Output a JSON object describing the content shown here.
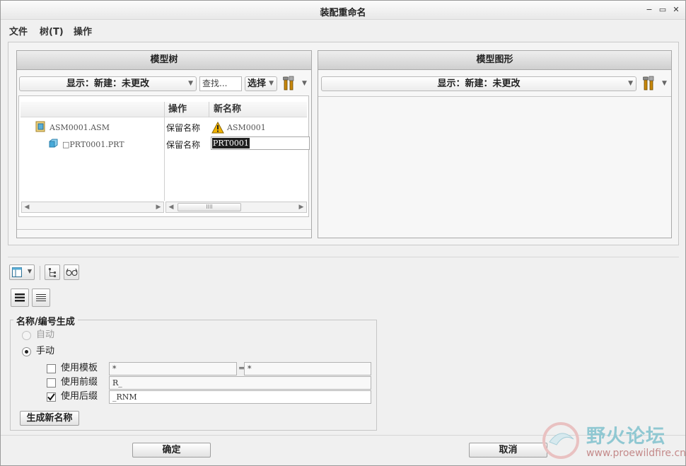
{
  "window": {
    "title": "装配重命名",
    "controls": [
      "−",
      "▭",
      "✕"
    ]
  },
  "menu": [
    "文件",
    "树(T)",
    "操作"
  ],
  "left_panel": {
    "title": "模型树",
    "display_dropdown": "显示：新建：未更改",
    "find_placeholder": "查找...",
    "select_dropdown": "选择",
    "columns": {
      "operation": "操作",
      "new_name": "新名称"
    },
    "rows": [
      {
        "name": "ASM0001.ASM",
        "operation": "保留名称",
        "new_name": "ASM0001",
        "warning": true
      },
      {
        "name": "□PRT0001.PRT",
        "operation": "保留名称",
        "new_name": "PRT0001",
        "warning": false
      }
    ],
    "scroll_thumb": "IIII"
  },
  "right_panel": {
    "title": "模型图形",
    "display_dropdown": "显示：新建：未更改"
  },
  "name_generation": {
    "title": "名称/编号生成",
    "auto_label": "自动",
    "manual_label": "手动",
    "use_template": {
      "label": "使用模板",
      "checked": false,
      "left": "*",
      "equals": "=",
      "right": "*"
    },
    "use_prefix": {
      "label": "使用前缀",
      "checked": false,
      "value": "R_"
    },
    "use_suffix": {
      "label": "使用后缀",
      "checked": true,
      "value": "_RNM"
    },
    "generate_button": "生成新名称"
  },
  "footer": {
    "ok": "确定",
    "cancel": "取消"
  },
  "watermark": {
    "text": "野火论坛",
    "url": "www.proewildfire.cn"
  },
  "colors": {
    "warning": "#f2b400",
    "part_icon": "#47a9d8"
  }
}
